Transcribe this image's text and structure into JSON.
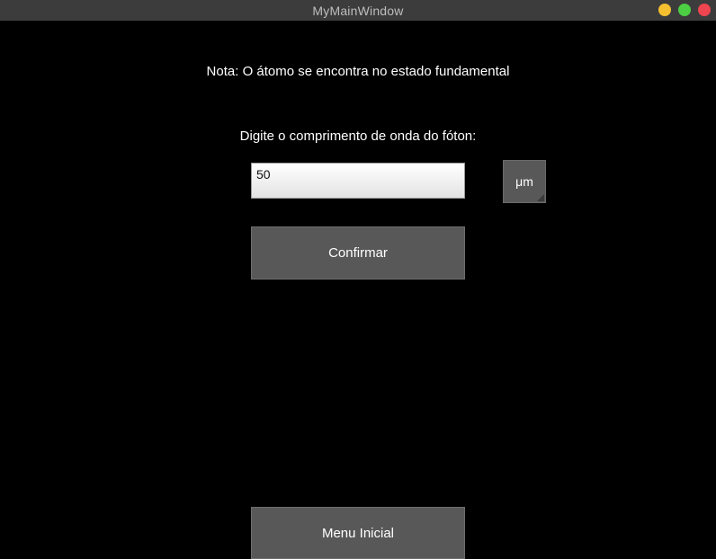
{
  "window": {
    "title": "MyMainWindow",
    "controls": [
      "minimize",
      "maximize",
      "close"
    ],
    "colors": {
      "background": "#000000",
      "titlebar": "#3c3c3c",
      "button": "#585858",
      "minimize": "#f5c02f",
      "maximize": "#4ccf43",
      "close": "#ef4550"
    }
  },
  "main": {
    "note": "Nota: O átomo se encontra no estado fundamental",
    "prompt": "Digite o comprimento de onda do fóton:",
    "wavelength_value": "50",
    "unit_label": "μm",
    "confirm_label": "Confirmar",
    "menu_label": "Menu Inicial"
  }
}
